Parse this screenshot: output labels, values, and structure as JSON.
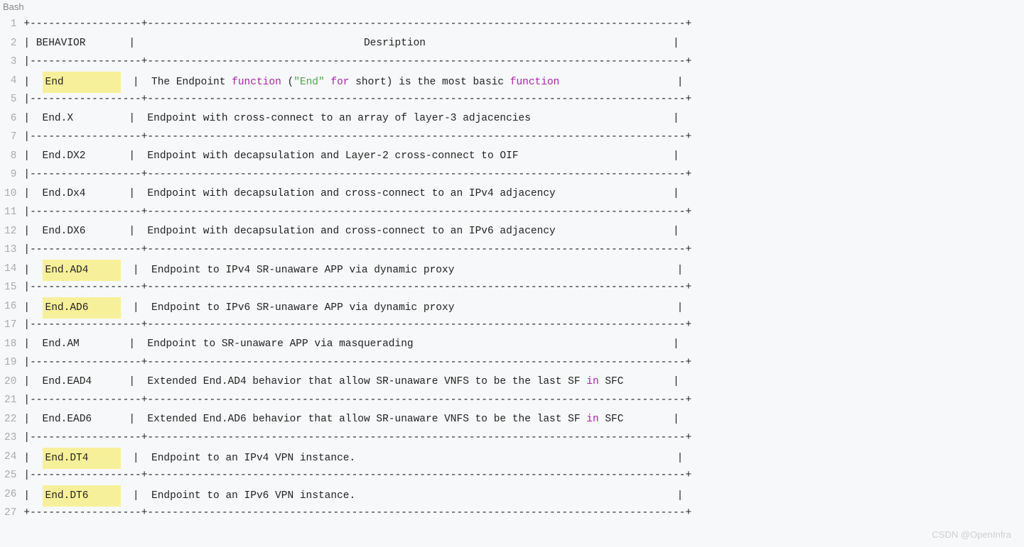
{
  "lang": "Bash",
  "watermark": "CSDN @OpenInfra",
  "sep_top": "+------------------+---------------------------------------------------------------------------------------+",
  "sep": "|------------------+---------------------------------------------------------------------------------------+",
  "header": {
    "c1": "BEHAVIOR",
    "c2": "Desription"
  },
  "rows": [
    {
      "hl": true,
      "name": "End",
      "desc_pre": "The Endpoint ",
      "kw1": "function",
      "desc_mid1": " (",
      "str": "\"End\"",
      "desc_mid2": " ",
      "kw2": "for",
      "desc_mid3": " short) is the most basic ",
      "kw3": "function",
      "desc_post": ""
    },
    {
      "hl": false,
      "name": "End.X",
      "desc": "Endpoint with cross-connect to an array of layer-3 adjacencies"
    },
    {
      "hl": false,
      "name": "End.DX2",
      "desc": "Endpoint with decapsulation and Layer-2 cross-connect to OIF"
    },
    {
      "hl": false,
      "name": "End.Dx4",
      "desc": "Endpoint with decapsulation and cross-connect to an IPv4 adjacency"
    },
    {
      "hl": false,
      "name": "End.DX6",
      "desc": "Endpoint with decapsulation and cross-connect to an IPv6 adjacency"
    },
    {
      "hl": true,
      "name": "End.AD4",
      "desc": "Endpoint to IPv4 SR-unaware APP via dynamic proxy"
    },
    {
      "hl": true,
      "name": "End.AD6",
      "desc": "Endpoint to IPv6 SR-unaware APP via dynamic proxy"
    },
    {
      "hl": false,
      "name": "End.AM",
      "desc": "Endpoint to SR-unaware APP via masquerading"
    },
    {
      "hl": false,
      "name": "End.EAD4",
      "desc_pre": "Extended End.AD4 behavior that allow SR-unaware VNFS to be the last SF ",
      "kw1": "in",
      "desc_post": " SFC"
    },
    {
      "hl": false,
      "name": "End.EAD6",
      "desc_pre": "Extended End.AD6 behavior that allow SR-unaware VNFS to be the last SF ",
      "kw1": "in",
      "desc_post": " SFC"
    },
    {
      "hl": true,
      "name": "End.DT4",
      "desc": "Endpoint to an IPv4 VPN instance."
    },
    {
      "hl": true,
      "name": "End.DT6",
      "desc": "Endpoint to an IPv6 VPN instance."
    }
  ]
}
